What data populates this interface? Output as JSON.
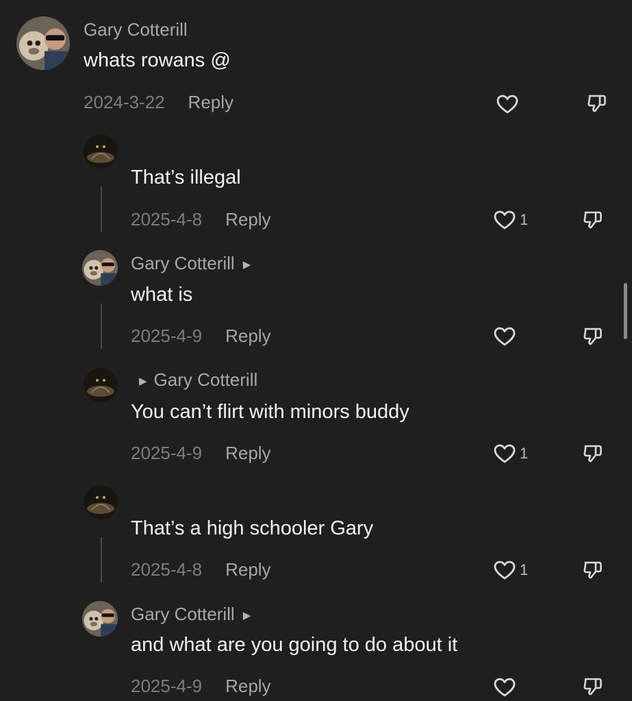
{
  "comments": [
    {
      "username": "Gary Cotterill",
      "text": "whats rowans @",
      "date": "2024-3-22",
      "reply_label": "Reply",
      "likes": "",
      "avatar": "gary-avatar-icon"
    },
    {
      "username": "",
      "text": "That’s illegal",
      "date": "2025-4-8",
      "reply_label": "Reply",
      "likes": "1",
      "avatar": "dark-avatar-icon"
    },
    {
      "username": "Gary Cotterill",
      "text": "what is",
      "date": "2025-4-9",
      "reply_label": "Reply",
      "likes": "",
      "avatar": "gary-avatar-icon"
    },
    {
      "username": "Gary Cotterill",
      "text": "You can’t flirt with minors buddy",
      "date": "2025-4-9",
      "reply_label": "Reply",
      "likes": "1",
      "avatar": "dark-avatar-icon"
    },
    {
      "username": "",
      "text": "That’s a high schooler Gary",
      "date": "2025-4-8",
      "reply_label": "Reply",
      "likes": "1",
      "avatar": "dark-avatar-icon"
    },
    {
      "username": "Gary Cotterill",
      "text": "and what are you going to do about it",
      "date": "2025-4-9",
      "reply_label": "Reply",
      "likes": "",
      "avatar": "gary-avatar-icon"
    }
  ],
  "colors": {
    "background": "#1f1f1f",
    "text": "#f2f2f2",
    "username": "#a9a9a9",
    "date": "#7c7c7c",
    "reply": "#a6a6a6"
  }
}
